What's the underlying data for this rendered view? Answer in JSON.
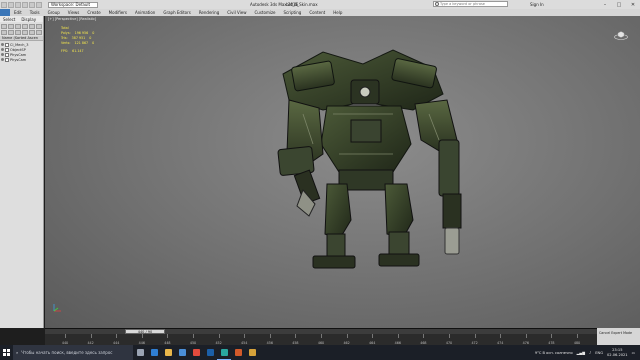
{
  "window": {
    "workspace_label": "Workspace: Default",
    "app_title": "Autodesk 3ds Max 2016",
    "file_title": "bot_6_Skin.max",
    "search_placeholder": "Type a keyword or phrase",
    "signin_label": "Sign In",
    "controls": [
      "–",
      "□",
      "✕"
    ]
  },
  "menubar": {
    "items": [
      "Edit",
      "Tools",
      "Group",
      "Views",
      "Create",
      "Modifiers",
      "Animation",
      "Graph Editors",
      "Rendering",
      "Civil View",
      "Customize",
      "Scripting",
      "Content",
      "Help"
    ]
  },
  "scene_explorer": {
    "tabs": [
      "Select",
      "Display"
    ],
    "column_header": "Name (Sorted Ascen",
    "items": [
      "Cl_Mech_3",
      "ObjectSP",
      "PhysCam",
      "PhysCam"
    ]
  },
  "viewport": {
    "label": "[+] [Perspective] [Realistic]",
    "stats_title": "Total",
    "stats": [
      {
        "label": "Polys:",
        "value": "196 956",
        "sel": "0"
      },
      {
        "label": "Tris:",
        "value": "387 951",
        "sel": "0"
      },
      {
        "label": "Verts:",
        "value": "121 867",
        "sel": "0"
      }
    ],
    "fps_label": "FPS:",
    "fps_value": "61.147",
    "axis_labels": [
      "x",
      "y",
      "z"
    ]
  },
  "timeline": {
    "frame_display": "440 / 90",
    "ticks": [
      "440",
      "442",
      "444",
      "446",
      "448",
      "450",
      "452",
      "454",
      "456",
      "458",
      "460",
      "462",
      "464",
      "466",
      "468",
      "470",
      "472",
      "474",
      "476",
      "478",
      "480"
    ]
  },
  "status": {
    "right_label": "Cancel Expert Mode"
  },
  "taskbar": {
    "search_placeholder": "Чтобы начать поиск, введите здесь запрос",
    "apps": [
      {
        "name": "task-view",
        "color": "#9aa3b3"
      },
      {
        "name": "edge",
        "color": "#2f7fd3"
      },
      {
        "name": "explorer",
        "color": "#e8b64a"
      },
      {
        "name": "store",
        "color": "#4a8fd8"
      },
      {
        "name": "chrome",
        "color": "#e34b3d"
      },
      {
        "name": "photoshop",
        "color": "#1b5fa8"
      },
      {
        "name": "3dsmax",
        "color": "#2aa8a0"
      },
      {
        "name": "media",
        "color": "#d35a2a"
      },
      {
        "name": "folder",
        "color": "#d6a23a"
      }
    ],
    "weather": "9°C  В осн. солнечно",
    "lang": "ENG",
    "time": "23:15",
    "date": "02.06.2021"
  }
}
